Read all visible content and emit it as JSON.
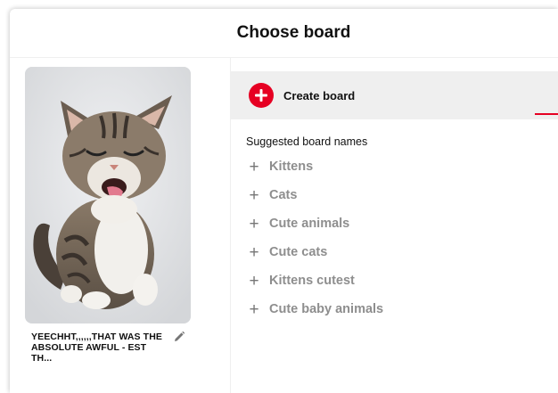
{
  "dialog": {
    "title": "Choose board"
  },
  "pin": {
    "caption": "YEECHHT,,,,,,THAT WAS THE ABSOLUTE AWFUL - EST TH...",
    "image": "yawning-kitten-photo"
  },
  "create_board": {
    "label": "Create board",
    "icon": "plus-circle-icon",
    "accent_color": "#e60023"
  },
  "suggestions": {
    "heading": "Suggested board names",
    "items": [
      {
        "label": "Kittens"
      },
      {
        "label": "Cats"
      },
      {
        "label": "Cute animals"
      },
      {
        "label": "Cute cats"
      },
      {
        "label": "Kittens cutest"
      },
      {
        "label": "Cute baby animals"
      }
    ]
  },
  "icons": {
    "edit": "pencil-icon",
    "add": "plus-icon"
  }
}
